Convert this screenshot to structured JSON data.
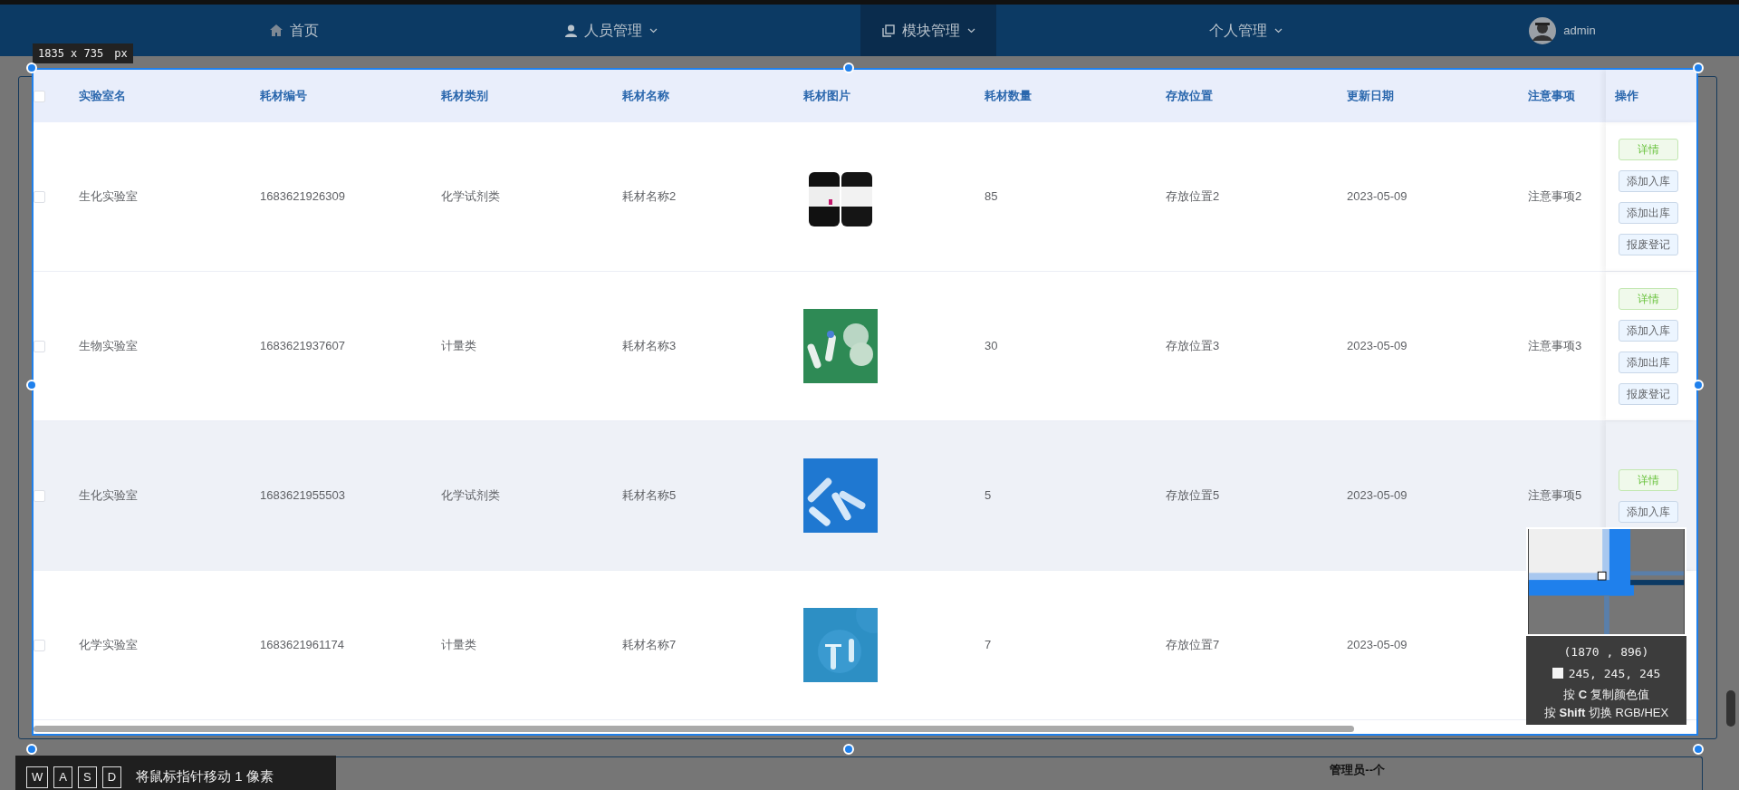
{
  "nav": [
    {
      "label": "首页",
      "caret": false,
      "selected": false
    },
    {
      "label": "人员管理",
      "caret": true,
      "selected": false
    },
    {
      "label": "模块管理",
      "caret": true,
      "selected": true
    },
    {
      "label": "个人管理",
      "caret": true,
      "selected": false
    }
  ],
  "user": {
    "name": "admin"
  },
  "capture": {
    "size": "1835 x 735",
    "unit": "px"
  },
  "table": {
    "columns": [
      "实验室名",
      "耗材编号",
      "耗材类别",
      "耗材名称",
      "耗材图片",
      "耗材数量",
      "存放位置",
      "更新日期",
      "注意事项"
    ],
    "action_column": "操作",
    "header_checked": false,
    "rows": [
      {
        "checked": false,
        "highlighted": false,
        "cells": [
          "生化实验室",
          "1683621926309",
          "化学试剂类",
          "耗材名称2",
          {
            "kind": "picture"
          },
          "85",
          "存放位置2",
          "2023-05-09",
          "注意事项2"
        ],
        "actions": [
          {
            "label": "详情",
            "kind": "success"
          },
          {
            "label": "添加入库",
            "kind": "plain"
          },
          {
            "label": "添加出库",
            "kind": "plain"
          },
          {
            "label": "报废登记",
            "kind": "plain"
          }
        ]
      },
      {
        "checked": false,
        "highlighted": false,
        "cells": [
          "生物实验室",
          "1683621937607",
          "计量类",
          "耗材名称3",
          {
            "kind": "picture"
          },
          "30",
          "存放位置3",
          "2023-05-09",
          "注意事项3"
        ],
        "actions": [
          {
            "label": "详情",
            "kind": "success"
          },
          {
            "label": "添加入库",
            "kind": "plain"
          },
          {
            "label": "添加出库",
            "kind": "plain"
          },
          {
            "label": "报废登记",
            "kind": "plain"
          }
        ]
      },
      {
        "checked": false,
        "highlighted": true,
        "cells": [
          "生化实验室",
          "1683621955503",
          "化学试剂类",
          "耗材名称5",
          {
            "kind": "picture"
          },
          "5",
          "存放位置5",
          "2023-05-09",
          "注意事项5"
        ],
        "actions": [
          {
            "label": "详情",
            "kind": "success"
          },
          {
            "label": "添加入库",
            "kind": "plain"
          }
        ]
      },
      {
        "checked": false,
        "highlighted": false,
        "cells": [
          "化学实验室",
          "1683621961174",
          "计量类",
          "耗材名称7",
          {
            "kind": "picture"
          },
          "7",
          "存放位置7",
          "2023-05-09"
        ],
        "actions": []
      }
    ]
  },
  "magnifier": {
    "coords": "(1870 , 896)",
    "color": "#f5f5f5",
    "color_value": "245, 245, 245",
    "hint_copy": "按 **C** 复制颜色值",
    "hint_switch": "按 **Shift** 切换 RGB/HEX"
  },
  "key_hint": {
    "keys": [
      "W",
      "A",
      "S",
      "D"
    ],
    "text": "将鼠标指针移动 1 像素"
  },
  "footer": {
    "text": "管理员--个"
  }
}
